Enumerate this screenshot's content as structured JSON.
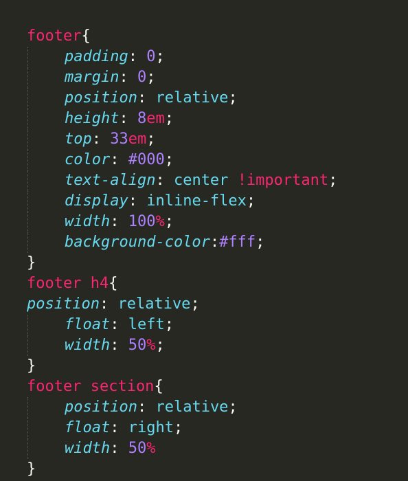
{
  "editor": {
    "theme": "monokai",
    "colors": {
      "background": "#272822",
      "selector": "#f92672",
      "property": "#66d9ef",
      "number": "#ae81ff",
      "unit": "#f92672",
      "keyword": "#66d9ef",
      "punctuation": "#f8f8f2",
      "indent_guide": "#5a5a52"
    },
    "lines": [
      {
        "indent": false,
        "tokens": [
          {
            "type": "sel",
            "text": "footer"
          },
          {
            "type": "punc",
            "text": "{"
          }
        ]
      },
      {
        "indent": true,
        "tokens": [
          {
            "type": "prop",
            "text": "padding"
          },
          {
            "type": "punc",
            "text": ": "
          },
          {
            "type": "num",
            "text": "0"
          },
          {
            "type": "punc",
            "text": ";"
          }
        ]
      },
      {
        "indent": true,
        "tokens": [
          {
            "type": "prop",
            "text": "margin"
          },
          {
            "type": "punc",
            "text": ": "
          },
          {
            "type": "num",
            "text": "0"
          },
          {
            "type": "punc",
            "text": ";"
          }
        ]
      },
      {
        "indent": true,
        "tokens": [
          {
            "type": "prop",
            "text": "position"
          },
          {
            "type": "punc",
            "text": ": "
          },
          {
            "type": "kw",
            "text": "relative"
          },
          {
            "type": "punc",
            "text": ";"
          }
        ]
      },
      {
        "indent": true,
        "tokens": [
          {
            "type": "prop",
            "text": "height"
          },
          {
            "type": "punc",
            "text": ": "
          },
          {
            "type": "num",
            "text": "8"
          },
          {
            "type": "unit",
            "text": "em"
          },
          {
            "type": "punc",
            "text": ";"
          }
        ]
      },
      {
        "indent": true,
        "tokens": [
          {
            "type": "prop",
            "text": "top"
          },
          {
            "type": "punc",
            "text": ": "
          },
          {
            "type": "num",
            "text": "33"
          },
          {
            "type": "unit",
            "text": "em"
          },
          {
            "type": "punc",
            "text": ";"
          }
        ]
      },
      {
        "indent": true,
        "tokens": [
          {
            "type": "prop",
            "text": "color"
          },
          {
            "type": "punc",
            "text": ": "
          },
          {
            "type": "num",
            "text": "#000"
          },
          {
            "type": "punc",
            "text": ";"
          }
        ]
      },
      {
        "indent": true,
        "tokens": [
          {
            "type": "prop",
            "text": "text-align"
          },
          {
            "type": "punc",
            "text": ": "
          },
          {
            "type": "kw",
            "text": "center"
          },
          {
            "type": "punc",
            "text": " "
          },
          {
            "type": "imp",
            "text": "!important"
          },
          {
            "type": "punc",
            "text": ";"
          }
        ]
      },
      {
        "indent": true,
        "tokens": [
          {
            "type": "prop",
            "text": "display"
          },
          {
            "type": "punc",
            "text": ": "
          },
          {
            "type": "kw",
            "text": "inline-flex"
          },
          {
            "type": "punc",
            "text": ";"
          }
        ]
      },
      {
        "indent": true,
        "tokens": [
          {
            "type": "prop",
            "text": "width"
          },
          {
            "type": "punc",
            "text": ": "
          },
          {
            "type": "num",
            "text": "100"
          },
          {
            "type": "unit",
            "text": "%"
          },
          {
            "type": "punc",
            "text": ";"
          }
        ]
      },
      {
        "indent": true,
        "tokens": [
          {
            "type": "prop",
            "text": "background-color"
          },
          {
            "type": "punc",
            "text": ":"
          },
          {
            "type": "num",
            "text": "#fff"
          },
          {
            "type": "punc",
            "text": ";"
          }
        ]
      },
      {
        "indent": false,
        "tokens": [
          {
            "type": "punc",
            "text": "}"
          }
        ]
      },
      {
        "indent": false,
        "tokens": [
          {
            "type": "sel",
            "text": "footer h4"
          },
          {
            "type": "punc",
            "text": "{"
          }
        ]
      },
      {
        "indent": false,
        "tokens": [
          {
            "type": "prop",
            "text": "position"
          },
          {
            "type": "punc",
            "text": ": "
          },
          {
            "type": "kw",
            "text": "relative"
          },
          {
            "type": "punc",
            "text": ";"
          }
        ]
      },
      {
        "indent": true,
        "tokens": [
          {
            "type": "prop",
            "text": "float"
          },
          {
            "type": "punc",
            "text": ": "
          },
          {
            "type": "kw",
            "text": "left"
          },
          {
            "type": "punc",
            "text": ";"
          }
        ]
      },
      {
        "indent": true,
        "tokens": [
          {
            "type": "prop",
            "text": "width"
          },
          {
            "type": "punc",
            "text": ": "
          },
          {
            "type": "num",
            "text": "50"
          },
          {
            "type": "unit",
            "text": "%"
          },
          {
            "type": "punc",
            "text": ";"
          }
        ]
      },
      {
        "indent": false,
        "tokens": [
          {
            "type": "punc",
            "text": "}"
          }
        ]
      },
      {
        "indent": false,
        "tokens": [
          {
            "type": "sel",
            "text": "footer section"
          },
          {
            "type": "punc",
            "text": "{"
          }
        ]
      },
      {
        "indent": true,
        "tokens": [
          {
            "type": "prop",
            "text": "position"
          },
          {
            "type": "punc",
            "text": ": "
          },
          {
            "type": "kw",
            "text": "relative"
          },
          {
            "type": "punc",
            "text": ";"
          }
        ]
      },
      {
        "indent": true,
        "tokens": [
          {
            "type": "prop",
            "text": "float"
          },
          {
            "type": "punc",
            "text": ": "
          },
          {
            "type": "kw",
            "text": "right"
          },
          {
            "type": "punc",
            "text": ";"
          }
        ]
      },
      {
        "indent": true,
        "tokens": [
          {
            "type": "prop",
            "text": "width"
          },
          {
            "type": "punc",
            "text": ": "
          },
          {
            "type": "num",
            "text": "50"
          },
          {
            "type": "unit",
            "text": "%"
          }
        ]
      },
      {
        "indent": false,
        "tokens": [
          {
            "type": "punc",
            "text": "}"
          }
        ]
      }
    ]
  }
}
